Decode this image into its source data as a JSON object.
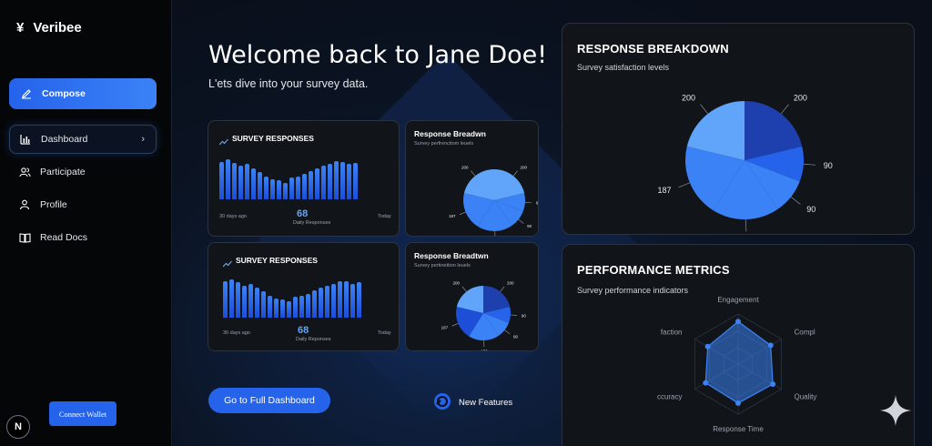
{
  "app": {
    "name": "Veribee",
    "logo_glyph": "¥"
  },
  "sidebar": {
    "compose_label": "Compose",
    "items": [
      {
        "label": "Dashboard",
        "icon": "bar-chart-icon",
        "active": true
      },
      {
        "label": "Participate",
        "icon": "users-icon"
      },
      {
        "label": "Profile",
        "icon": "user-icon"
      },
      {
        "label": "Read Docs",
        "icon": "book-icon"
      }
    ],
    "wallet_label": "Connect Wallet",
    "badge_letter": "N"
  },
  "header": {
    "title": "Welcome back to Jane Doe!",
    "subtitle": "L'ets dive into your survey data."
  },
  "mini_cards": [
    {
      "title": "SURVEY RESPONSES",
      "value": "68",
      "value_label": "Daily Responses",
      "left_label": "30 days ago",
      "right_label": "Today",
      "bars": [
        0.9,
        0.95,
        0.88,
        0.8,
        0.85,
        0.75,
        0.65,
        0.55,
        0.48,
        0.45,
        0.4,
        0.52,
        0.55,
        0.6,
        0.68,
        0.75,
        0.8,
        0.85,
        0.92,
        0.9,
        0.85,
        0.88
      ]
    },
    {
      "title": "SURVEY RESPONSES",
      "value": "68",
      "value_label": "Daily Reponses",
      "left_label": "30 days ago",
      "right_label": "Today",
      "bars": [
        0.9,
        0.95,
        0.88,
        0.8,
        0.85,
        0.75,
        0.65,
        0.55,
        0.48,
        0.45,
        0.4,
        0.52,
        0.55,
        0.6,
        0.68,
        0.75,
        0.8,
        0.85,
        0.92,
        0.9,
        0.85,
        0.88
      ]
    }
  ],
  "mini_pies": [
    {
      "title": "Response Breadwn",
      "subtitle": "Survey perfrenctiom leuels",
      "labels": [
        "200",
        "90",
        "90",
        "173",
        "187",
        "200"
      ]
    },
    {
      "title": "Response Breadtwn",
      "subtitle": "Survey pertinettion leuels",
      "labels": [
        "200",
        "90",
        "90",
        "173",
        "187",
        "200"
      ]
    }
  ],
  "buttons": {
    "full_dashboard": "Go to Full Dashboard",
    "new_features": "New Features"
  },
  "response_breakdown": {
    "title": "RESPONSE BREAKDOWN",
    "subtitle": "Survey satisfaction levels"
  },
  "performance": {
    "title": "PERFORMANCE METRICS",
    "subtitle": "Survey performance indicators",
    "axes": [
      "Engagement",
      "Compl",
      "Quality",
      "Response Time",
      "ccuracy",
      "faction"
    ],
    "values": [
      0.85,
      0.75,
      0.8,
      0.78,
      0.75,
      0.7
    ]
  },
  "chart_data": {
    "type": "pie",
    "title": "RESPONSE BREAKDOWN",
    "categories": [
      "200",
      "90",
      "90",
      "173",
      "187",
      "200"
    ],
    "values": [
      200,
      90,
      90,
      173,
      187,
      200
    ],
    "colors": [
      "#1e40af",
      "#2563eb",
      "#3b82f6",
      "#3b82f6",
      "#3b82f6",
      "#60a5fa"
    ]
  },
  "colors": {
    "accent": "#2563eb",
    "accent_light": "#60a5fa",
    "card_bg": "#111418"
  }
}
